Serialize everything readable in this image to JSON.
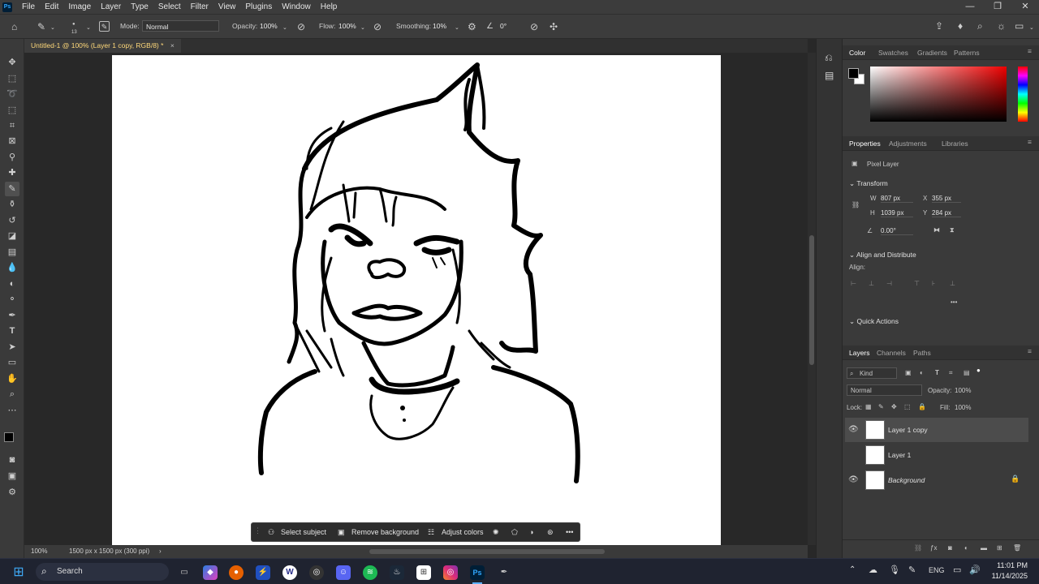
{
  "app": {
    "logo": "Ps"
  },
  "menu": [
    "File",
    "Edit",
    "Image",
    "Layer",
    "Type",
    "Select",
    "Filter",
    "View",
    "Plugins",
    "Window",
    "Help"
  ],
  "window_controls": {
    "minimize": "—",
    "maximize": "❐",
    "close": "✕"
  },
  "options": {
    "brush_size": "13",
    "mode_label": "Mode:",
    "mode_value": "Normal",
    "opacity_label": "Opacity:",
    "opacity_value": "100%",
    "flow_label": "Flow:",
    "flow_value": "100%",
    "smoothing_label": "Smoothing:",
    "smoothing_value": "10%",
    "angle_value": "0°"
  },
  "document_tab": {
    "title": "Untitled-1 @ 100% (Layer 1 copy, RGB/8) *",
    "close": "×"
  },
  "context_bar": {
    "select_subject": "Select subject",
    "remove_background": "Remove background",
    "adjust_colors": "Adjust colors",
    "more": "•••"
  },
  "status": {
    "zoom": "100%",
    "doc_info": "1500 px x 1500 px (300 ppi)"
  },
  "color_panel": {
    "tabs": [
      "Color",
      "Swatches",
      "Gradients",
      "Patterns"
    ],
    "active": "Color"
  },
  "properties_panel": {
    "tabs": [
      "Properties",
      "Adjustments",
      "Libraries"
    ],
    "layer_type": "Pixel Layer",
    "transform_title": "Transform",
    "w_label": "W",
    "w_value": "807 px",
    "x_label": "X",
    "x_value": "355 px",
    "h_label": "H",
    "h_value": "1039 px",
    "y_label": "Y",
    "y_value": "284 px",
    "angle_value": "0.00°",
    "align_title": "Align and Distribute",
    "align_label": "Align:",
    "more": "•••",
    "quick_actions_title": "Quick Actions"
  },
  "layers_panel": {
    "tabs": [
      "Layers",
      "Channels",
      "Paths"
    ],
    "filter_kind": "Kind",
    "blend_mode": "Normal",
    "opacity_label": "Opacity:",
    "opacity_value": "100%",
    "lock_label": "Lock:",
    "fill_label": "Fill:",
    "fill_value": "100%",
    "layers": [
      {
        "name": "Layer 1 copy",
        "visible": true,
        "selected": true
      },
      {
        "name": "Layer 1",
        "visible": false,
        "selected": false
      },
      {
        "name": "Background",
        "visible": true,
        "selected": false,
        "locked": true
      }
    ]
  },
  "taskbar": {
    "search_label": "Search",
    "language": "ENG",
    "time": "11:01 PM",
    "date": "11/14/2025"
  },
  "colors": {
    "fg": "#000000",
    "bg": "#ffffff",
    "accent": "#1473e6",
    "tab_text": "#ffd97a"
  }
}
